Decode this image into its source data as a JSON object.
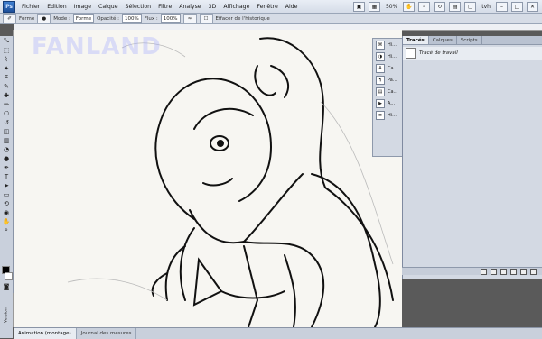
{
  "menubar": {
    "logo": "Ps",
    "items": [
      "Fichier",
      "Edition",
      "Image",
      "Calque",
      "Sélection",
      "Filtre",
      "Analyse",
      "3D",
      "Affichage",
      "Fenêtre",
      "Aide"
    ],
    "zoom": "50%",
    "workspace": "tvh"
  },
  "options": {
    "shape_label": "Forme",
    "mode_label": "Mode :",
    "mode_value": "Forme",
    "opacity_label": "Opacité :",
    "opacity_value": "100%",
    "flow_label": "Flux :",
    "flow_value": "100%",
    "history_label": "Effacer de l'historique"
  },
  "panel": {
    "tabs": [
      "Tracés",
      "Calques",
      "Scripts"
    ],
    "active_tab": "Tracés",
    "path_label": "Tracé de travail",
    "dock_items": [
      "Hi...",
      "Hi...",
      "Ca...",
      "Pa...",
      "Ca...",
      "A...",
      "Hi..."
    ]
  },
  "bottom": {
    "tabs": [
      "Animation (montage)",
      "Journal des mesures"
    ]
  },
  "canvas": {
    "watermark": "FANLAND"
  },
  "sidebar_label": "Version"
}
